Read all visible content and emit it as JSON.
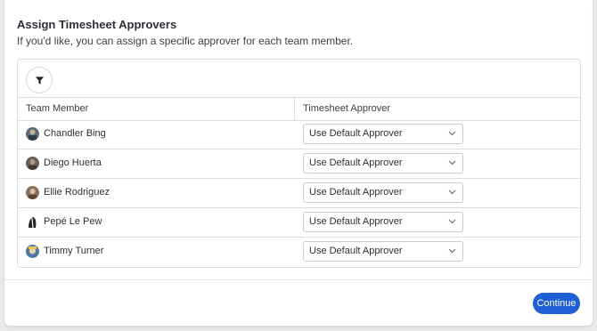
{
  "header": {
    "title": "Assign Timesheet Approvers",
    "subtitle": "If you'd like, you can assign a specific approver for each team member."
  },
  "table": {
    "filter_icon": "filter-icon",
    "columns": [
      "Team Member",
      "Timesheet Approver"
    ],
    "rows": [
      {
        "name": "Chandler Bing",
        "approver": "Use Default Approver",
        "avatar_color": "#5b6b7a"
      },
      {
        "name": "Diego Huerta",
        "approver": "Use Default Approver",
        "avatar_color": "#6a5d52"
      },
      {
        "name": "Ellie Rodriguez",
        "approver": "Use Default Approver",
        "avatar_color": "#8a6f5a"
      },
      {
        "name": "Pepé Le Pew",
        "approver": "Use Default Approver",
        "avatar_color": "#222222"
      },
      {
        "name": "Timmy Turner",
        "approver": "Use Default Approver",
        "avatar_color": "#4d7aa8"
      }
    ]
  },
  "footer": {
    "continue_label": "Continue"
  },
  "colors": {
    "accent": "#1e5fd6"
  }
}
